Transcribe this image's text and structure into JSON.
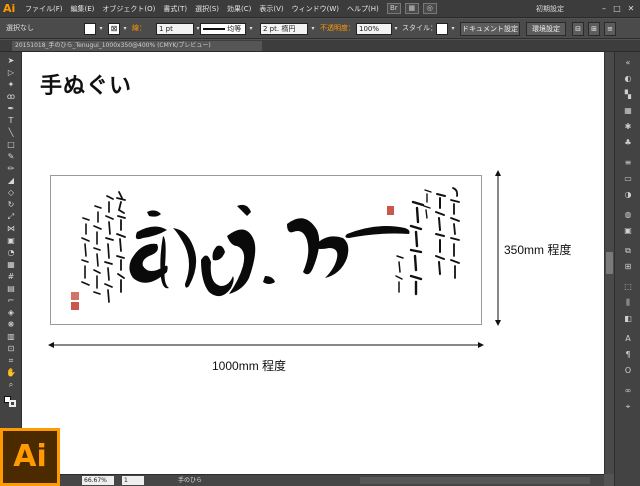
{
  "app": {
    "logo": "Ai",
    "menu": [
      "ファイル(F)",
      "編集(E)",
      "オブジェクト(O)",
      "書式(T)",
      "選択(S)",
      "効果(C)",
      "表示(V)",
      "ウィンドウ(W)",
      "ヘルプ(H)"
    ],
    "workspace": "初期設定",
    "window_buttons": [
      "–",
      "□",
      "✕"
    ]
  },
  "control_bar": {
    "selection": "選択なし",
    "stroke_label": "線：",
    "stroke_width": "1 pt",
    "stroke_profile": "均等",
    "brush": "2 pt. 楕円",
    "opacity_label": "不透明度：",
    "opacity_value": "100%",
    "style_label": "スタイル：",
    "doc_settings": "ドキュメント設定",
    "preferences": "環境設定"
  },
  "document": {
    "tab_name": "20151018_手のひら_Tenugui_1000x350@400% (CMYK/プレビュー)",
    "page_title": "手ぬぐい",
    "height_label": "350mm 程度",
    "width_label": "1000mm 程度"
  },
  "status": {
    "zoom": "66.67%",
    "page": "1",
    "artboard_name": "手のひら"
  },
  "big_logo": "Ai",
  "colors": {
    "accent": "#ff9a00",
    "ui_dark": "#3c3c3c",
    "canvas": "#ffffff",
    "seal_red": "#c0392b"
  }
}
